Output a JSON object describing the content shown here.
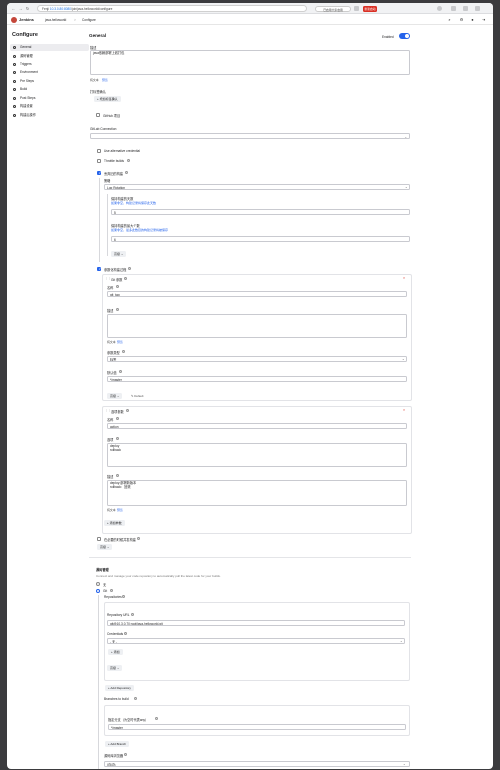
{
  "browser": {
    "url_prefix": "Fenji",
    "url_host": "10.3.0.80:8080",
    "url_path": "/job/java-helloworld/configure",
    "ext_label": "已启用大家启用",
    "ext_red_label": "重新启动"
  },
  "header": {
    "app_title": "Jenkins",
    "crumb_job": "java-helloworld",
    "crumb_sep": ">",
    "crumb_page": "Configure"
  },
  "sidebar": {
    "title": "Configure",
    "items": [
      {
        "label": "General",
        "icon": "gear-icon"
      },
      {
        "label": "源码管理",
        "icon": "code-icon"
      },
      {
        "label": "Triggers",
        "icon": "clock-icon"
      },
      {
        "label": "Environment",
        "icon": "globe-icon"
      },
      {
        "label": "Pre Steps",
        "icon": "steps-icon"
      },
      {
        "label": "Build",
        "icon": "hammer-icon"
      },
      {
        "label": "Post Steps",
        "icon": "steps-icon"
      },
      {
        "label": "构建设置",
        "icon": "settings-icon"
      },
      {
        "label": "构建后操作",
        "icon": "cube-icon"
      }
    ]
  },
  "main": {
    "title": "General",
    "enabled_label": "Enabled",
    "description_label": "描述",
    "description_value": "java依赖部署上线打包",
    "plain_text": "纯文本",
    "preview": "预览",
    "labels_label": "打标签确认",
    "labels_btn": "+ 增加标签确认",
    "github_project": "GitHub 项目",
    "gitlab_connection_label": "GitLab Connection",
    "alt_credential": "Use alternative credential",
    "throttle": "Throttle builds",
    "discard_label": "丢弃旧的构建",
    "strategy_label": "策略",
    "strategy_value": "Log Rotation",
    "keep_days_label": "保持构建的天数",
    "keep_days_sub": "如果非空，构建记录将保存此天数",
    "keep_days_value": "5",
    "keep_max_label": "保持构建的最大个数",
    "keep_max_sub": "如果非空，最多此数目的构建记录将被保存",
    "keep_max_value": "6",
    "advanced_btn": "高级",
    "params_label": "参数化构建过程",
    "git_param_title": "Git 参数",
    "name_label": "名称",
    "git_name_value": "git_tag",
    "desc_label": "描述",
    "param_type_label": "参数类型",
    "param_type_value": "标签",
    "default_value_label": "默认值",
    "default_value": "*/master",
    "advanced_btn2": "高级",
    "default_link": "Default",
    "choice_param_title": "选项参数",
    "choice_name_value": "action",
    "options_label": "选项",
    "options_value": "deploy\nrollback",
    "choice_desc_label": "描述",
    "choice_desc_value": "deploy:部署新版本\nrollback：回滚",
    "add_param_btn": "+ 添加参数",
    "concurrent_label": "在必要的时候并发构建",
    "advanced_btn3": "高级",
    "scm_title": "源码管理",
    "scm_desc": "Connect and manage your code repository to automatically pull the latest code for your builds.",
    "scm_none": "无",
    "scm_git": "Git",
    "repos_label": "Repositories",
    "repo_url_label": "Repository URL",
    "repo_url_value": "git@10.3.0.70:root/java-helloworld.git",
    "credentials_label": "Credentials",
    "credentials_value": "- 无 -",
    "add_btn": "+ 添加",
    "advanced_btn4": "高级",
    "add_repo_btn": "+ Add Repository",
    "branches_label": "Branches to build",
    "branch_spec_label": "指定分支（为空时代表any）",
    "branch_spec_value": "*/master",
    "add_branch_btn": "+ Add Branch",
    "browser_label": "源码库浏览器",
    "browser_value": "(自动)"
  }
}
